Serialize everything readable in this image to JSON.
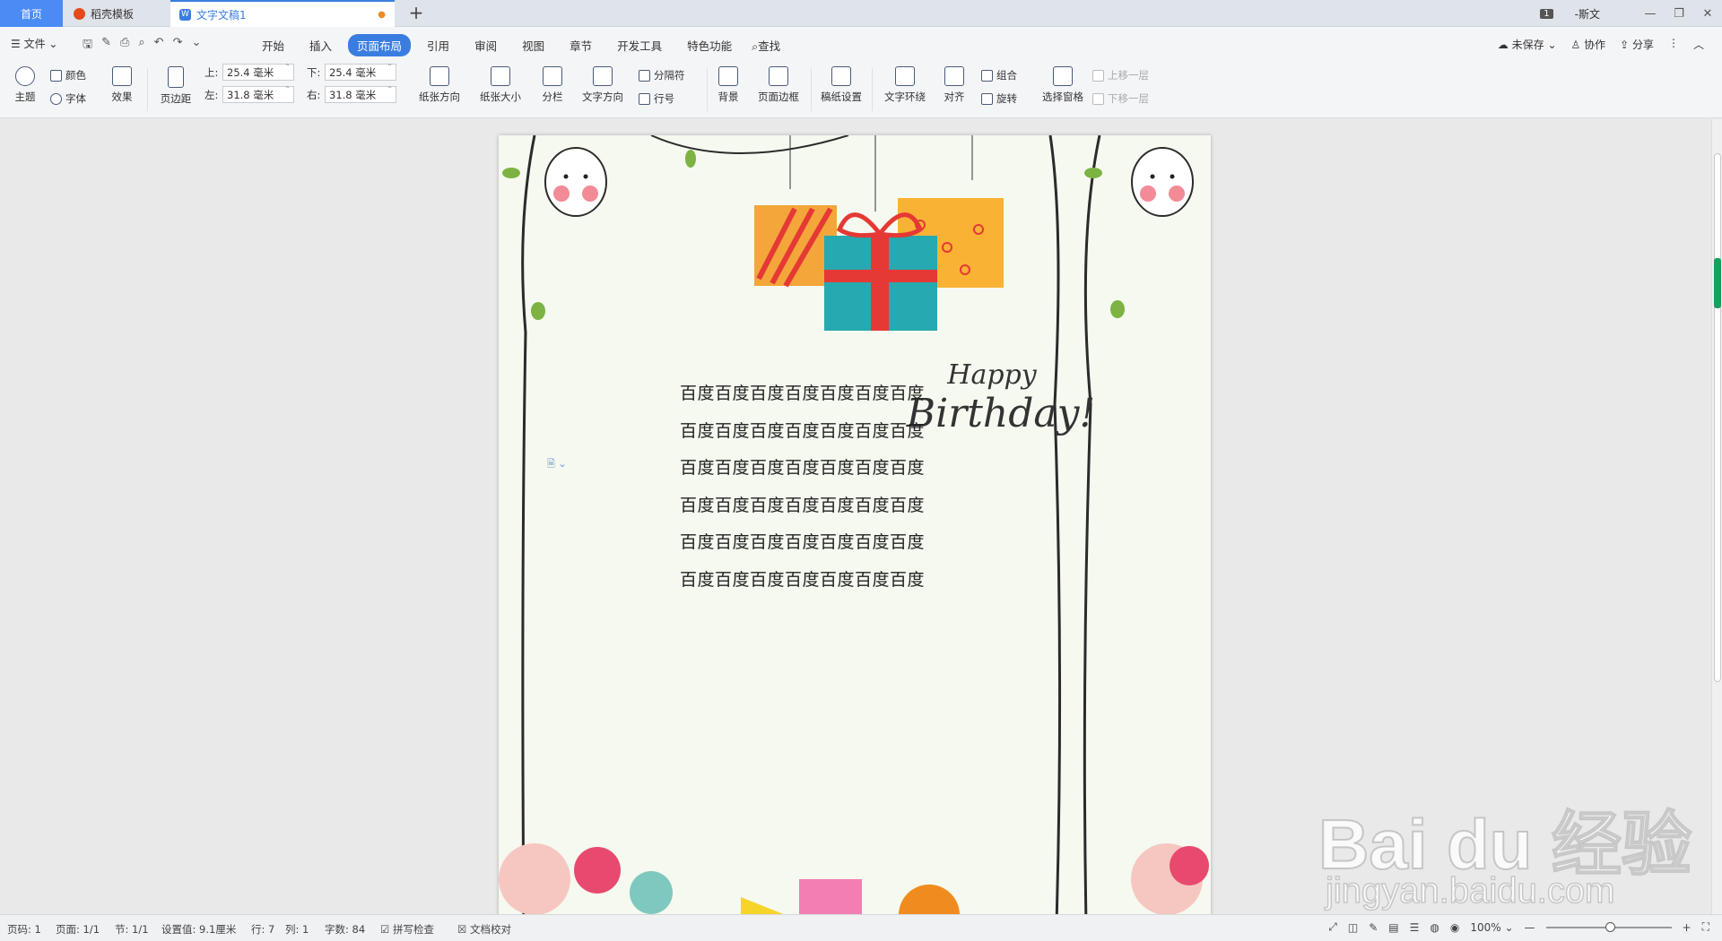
{
  "tabs": {
    "home": "首页",
    "template": "稻壳模板",
    "document": "文字文稿1",
    "add": "+"
  },
  "window": {
    "badge": "1",
    "user": "-斯文"
  },
  "menu": {
    "file": "文件",
    "tabs": [
      "开始",
      "插入",
      "页面布局",
      "引用",
      "审阅",
      "视图",
      "章节",
      "开发工具",
      "特色功能"
    ],
    "active_tab": "页面布局",
    "search": "查找",
    "unsaved": "未保存",
    "collab": "协作",
    "share": "分享"
  },
  "ribbon": {
    "theme": "主题",
    "color": "颜色",
    "font": "字体",
    "effect": "效果",
    "margins": "页边距",
    "top_label": "上:",
    "top_value": "25.4 毫米",
    "bottom_label": "下:",
    "bottom_value": "25.4 毫米",
    "left_label": "左:",
    "left_value": "31.8 毫米",
    "right_label": "右:",
    "right_value": "31.8 毫米",
    "orientation": "纸张方向",
    "size": "纸张大小",
    "columns": "分栏",
    "text_direction": "文字方向",
    "separator": "分隔符",
    "line_numbers": "行号",
    "background": "背景",
    "page_border": "页面边框",
    "manuscript": "稿纸设置",
    "text_wrap": "文字环绕",
    "align": "对齐",
    "group": "组合",
    "rotate": "旋转",
    "selection_pane": "选择窗格",
    "bring_forward": "上移一层",
    "send_backward": "下移一层"
  },
  "document": {
    "happy": "Happy",
    "birthday": "Birthday!",
    "lines": [
      "百度百度百度百度百度百度百度",
      "百度百度百度百度百度百度百度",
      "百度百度百度百度百度百度百度",
      "百度百度百度百度百度百度百度",
      "百度百度百度百度百度百度百度",
      "百度百度百度百度百度百度百度"
    ]
  },
  "status": {
    "page_no": "页码: 1",
    "pages": "页面: 1/1",
    "section": "节: 1/1",
    "setting": "设置值: 9.1厘米",
    "row": "行: 7",
    "col": "列: 1",
    "words": "字数: 84",
    "spell": "拼写检查",
    "proof": "文档校对",
    "zoom": "100%"
  },
  "watermark": {
    "main": "Bai du 经验",
    "sub": "jingyan.baidu.com"
  }
}
